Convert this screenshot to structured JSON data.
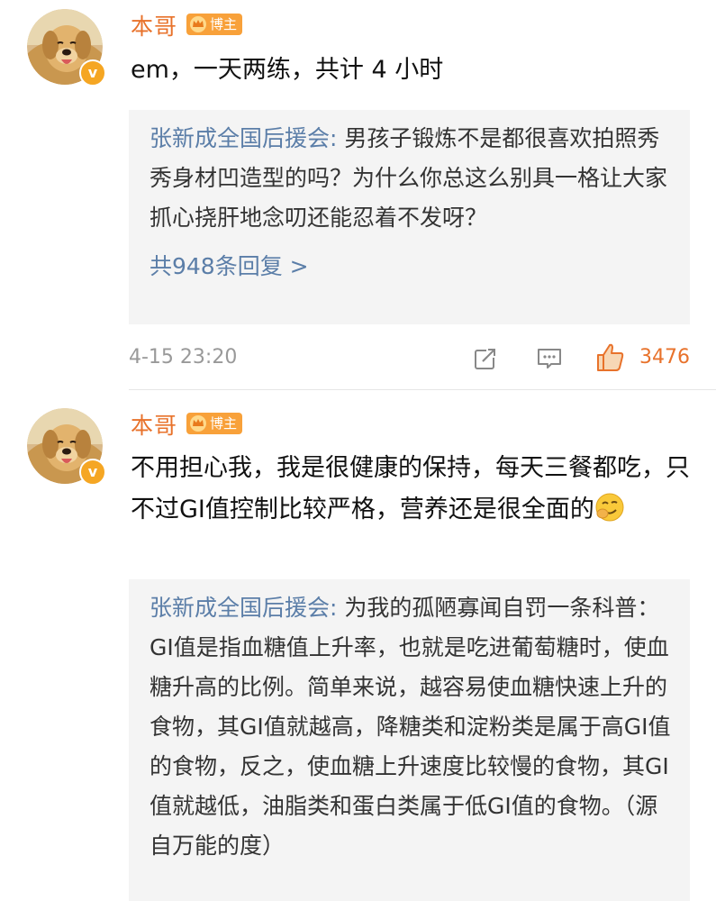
{
  "comments": [
    {
      "username": "本哥",
      "badge": "博主",
      "text": "em，一天两练，共计 4 小时",
      "reply": {
        "author": "张新成全国后援会",
        "separator": ":",
        "text": " 男孩子锻炼不是都很喜欢拍照秀秀身材凹造型的吗？为什么你总这么别具一格让大家抓心挠肝地念叨还能忍着不发呀？",
        "count_label": "共948条回复 >"
      },
      "timestamp": "4-15 23:20",
      "likes": "3476",
      "icons": [
        "share-icon",
        "comment-icon",
        "like-icon"
      ]
    },
    {
      "username": "本哥",
      "badge": "博主",
      "text": "不用担心我，我是很健康的保持，每天三餐都吃，只不过GI值控制比较严格，营养还是很全面的",
      "emoji": "smirk-emoji",
      "reply": {
        "author": "张新成全国后援会",
        "separator": ":",
        "text": " 为我的孤陋寡闻自罚一条科普：GI值是指血糖值上升率，也就是吃进葡萄糖时，使血糖升高的比例。简单来说，越容易使血糖快速上升的食物，其GI值就越高，降糖类和淀粉类是属于高GI值的食物，反之，使血糖上升速度比较慢的食物，其GI值就越低，油脂类和蛋白类属于低GI值的食物。（源自万能的度）"
      }
    }
  ],
  "colors": {
    "username": "#e8722b",
    "reply_author": "#5b7ea8",
    "like": "#e8722b",
    "badge": "#f8a13a"
  }
}
